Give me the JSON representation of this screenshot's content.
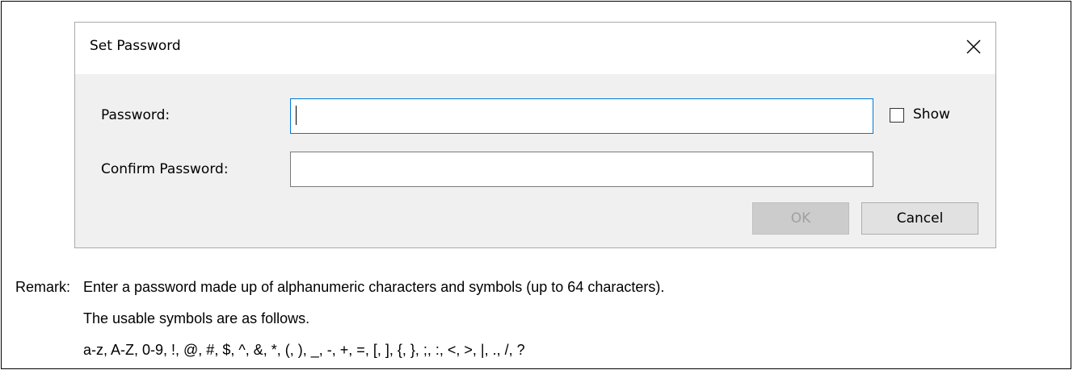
{
  "dialog": {
    "title": "Set Password",
    "password_label": "Password:",
    "password_value": "",
    "confirm_label": "Confirm Password:",
    "confirm_value": "",
    "show_label": "Show",
    "show_checked": false,
    "ok_label": "OK",
    "ok_enabled": false,
    "cancel_label": "Cancel"
  },
  "remark": {
    "label": "Remark:",
    "lines": [
      "Enter a password made up of alphanumeric characters and symbols (up to 64 characters).",
      "The usable symbols are as follows.",
      "a-z, A-Z, 0-9, !, @, #, $, ^, &, *, (, ), _, -, +, =, [, ], {, }, ;, :, <, >, |, ., /, ?"
    ]
  },
  "colors": {
    "dialog_bg": "#f0f0f0",
    "titlebar_bg": "#ffffff",
    "focus_border": "#0078d7",
    "disabled_button_bg": "#cccccc",
    "disabled_text": "#a0a0a0"
  }
}
